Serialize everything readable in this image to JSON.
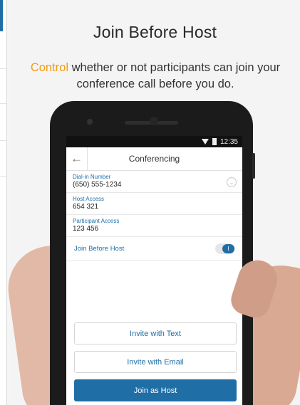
{
  "slide": {
    "title": "Join Before Host",
    "subtitle_accent": "Control",
    "subtitle_rest": " whether or not participants can join your conference call before you do."
  },
  "status_bar": {
    "time": "12:35"
  },
  "app_bar": {
    "back_glyph": "←",
    "title": "Conferencing"
  },
  "fields": [
    {
      "label": "Dial-in Number",
      "value": "(650) 555-1234"
    },
    {
      "label": "Host Access",
      "value": "654 321"
    },
    {
      "label": "Participant Access",
      "value": "123 456"
    }
  ],
  "toggle": {
    "label": "Join Before Host",
    "state_glyph": "I",
    "on": true
  },
  "buttons": {
    "invite_text": "Invite with Text",
    "invite_email": "Invite with Email",
    "join_host": "Join as Host"
  },
  "colors": {
    "accent_orange": "#f39c12",
    "brand_blue": "#1f6fa6"
  },
  "icons": [
    "back-arrow-icon",
    "wifi-icon",
    "battery-icon",
    "chevron-down-icon"
  ]
}
